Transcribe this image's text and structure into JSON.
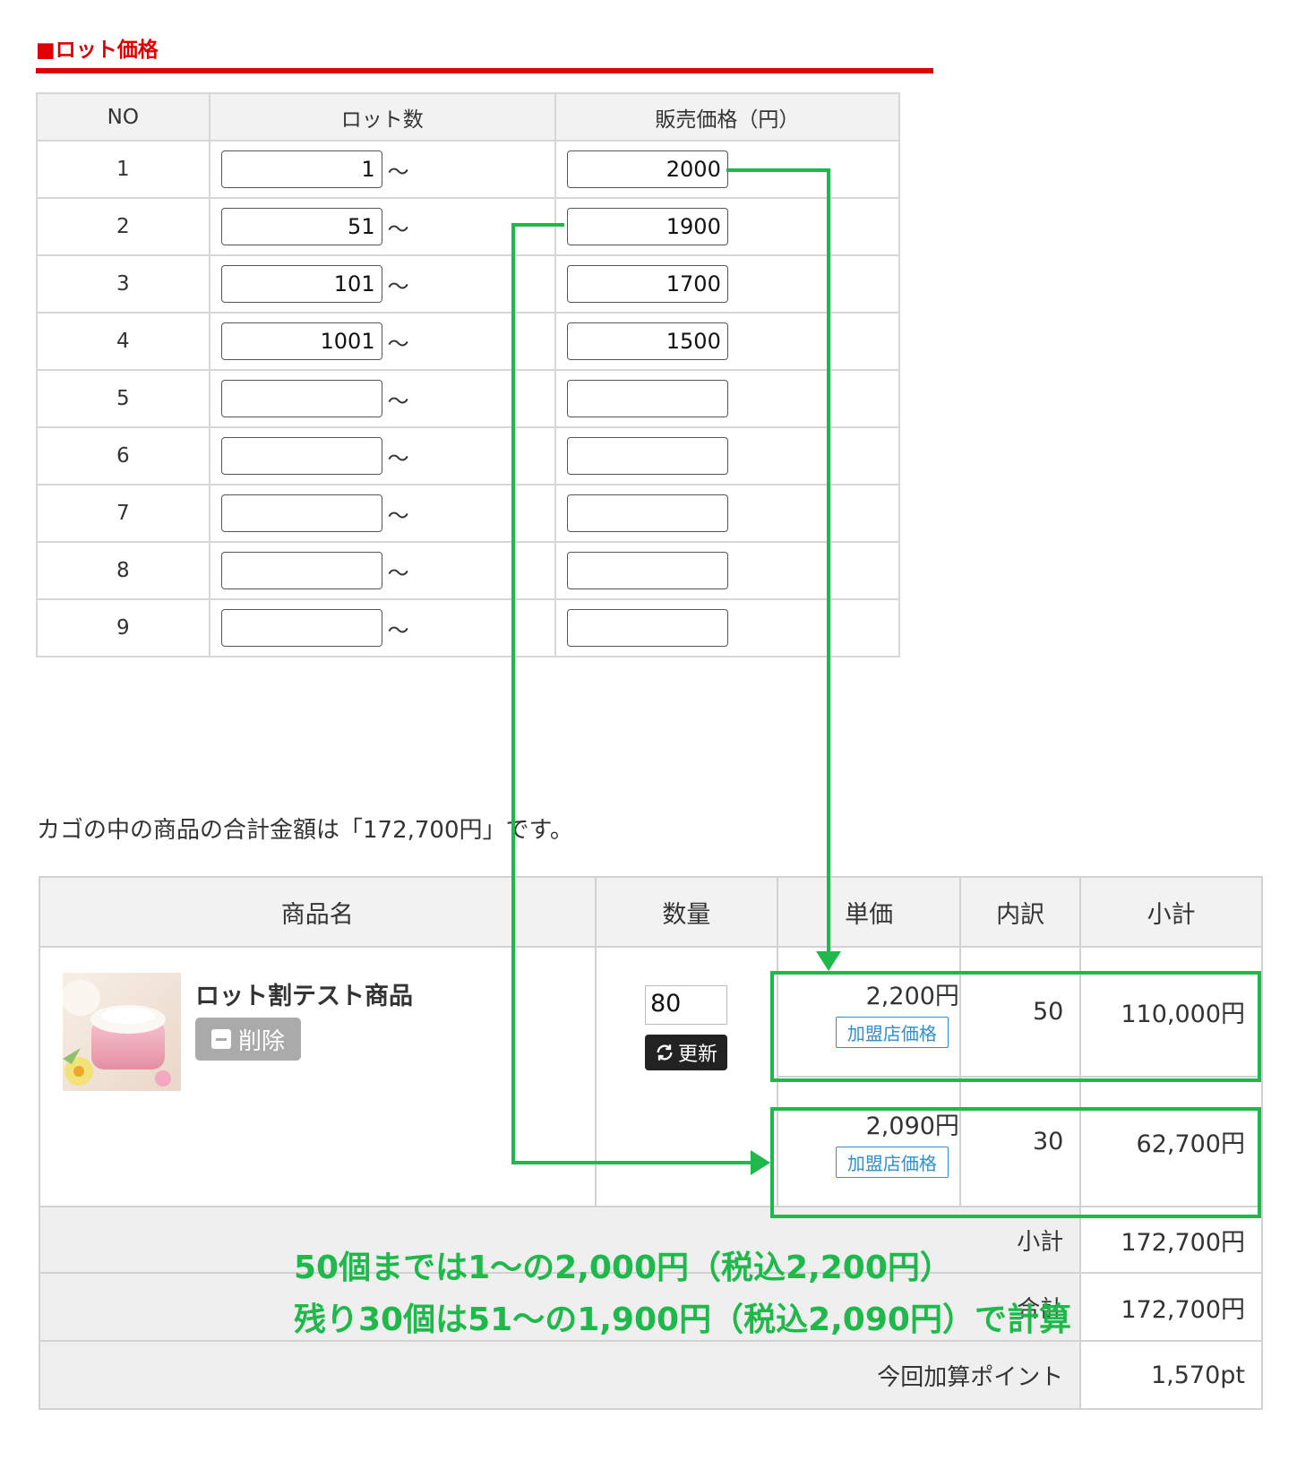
{
  "lot_section": {
    "title": "■ロット価格",
    "headers": {
      "no": "NO",
      "lot": "ロット数",
      "price": "販売価格（円）"
    },
    "tilde": "〜",
    "rows": [
      {
        "no": "1",
        "lot": "1",
        "price": "2000"
      },
      {
        "no": "2",
        "lot": "51",
        "price": "1900"
      },
      {
        "no": "3",
        "lot": "101",
        "price": "1700"
      },
      {
        "no": "4",
        "lot": "1001",
        "price": "1500"
      },
      {
        "no": "5",
        "lot": "",
        "price": ""
      },
      {
        "no": "6",
        "lot": "",
        "price": ""
      },
      {
        "no": "7",
        "lot": "",
        "price": ""
      },
      {
        "no": "8",
        "lot": "",
        "price": ""
      },
      {
        "no": "9",
        "lot": "",
        "price": ""
      }
    ]
  },
  "cart": {
    "summary": "カゴの中の商品の合計金額は「172,700円」です。",
    "headers": {
      "name": "商品名",
      "qty": "数量",
      "unit": "単価",
      "breakdown": "内訳",
      "subtotal": "小計"
    },
    "product": {
      "name": "ロット割テスト商品",
      "delete_label": "削除",
      "qty": "80",
      "update_label": "更新"
    },
    "lines": [
      {
        "unit_price": "2,200円",
        "badge": "加盟店価格",
        "count": "50",
        "subtotal": "110,000円"
      },
      {
        "unit_price": "2,090円",
        "badge": "加盟店価格",
        "count": "30",
        "subtotal": "62,700円"
      }
    ],
    "footer": {
      "subtotal_label": "小計",
      "subtotal_value": "172,700円",
      "total_label": "合計",
      "total_value": "172,700円",
      "points_label": "今回加算ポイント",
      "points_value": "1,570pt"
    }
  },
  "annotation": {
    "line1": "50個までは1〜の2,000円（税込2,200円）",
    "line2": "残り30個は51〜の1,900円（税込2,090円）で計算",
    "color": "#1fb84a"
  },
  "colors": {
    "accent_red": "#e00000",
    "header_bg": "#f2f2f2",
    "badge_blue": "#2f8fd0"
  }
}
